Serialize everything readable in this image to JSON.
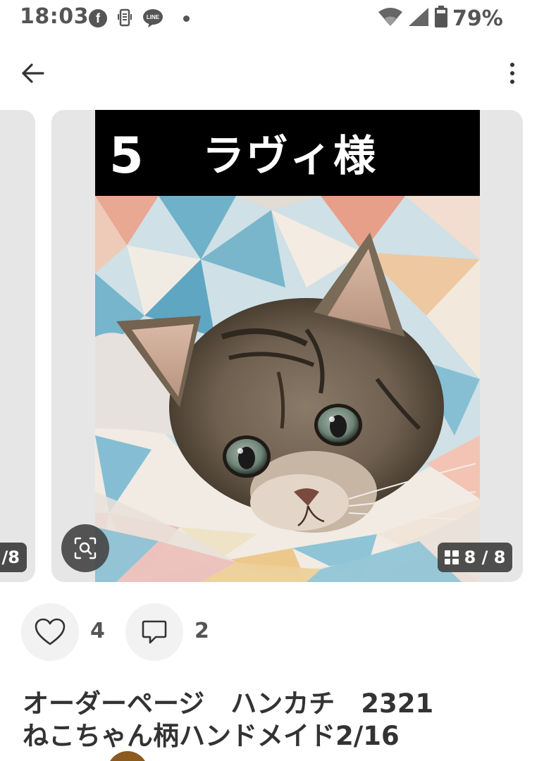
{
  "status_bar": {
    "time": "18:03",
    "battery": "79%",
    "line_label": "LINE"
  },
  "nav": {
    "back_icon": "arrow-left-icon",
    "menu_icon": "more-vertical-icon"
  },
  "carousel": {
    "prev_counter": "/8",
    "image": {
      "number": "5",
      "name": "ラヴィ様",
      "subject": "tabby kitten on pastel knitted blanket"
    },
    "lens_icon": "visual-search-icon",
    "counter": "8 / 8"
  },
  "actions": {
    "like_icon": "heart-outline-icon",
    "like_count": "4",
    "comment_icon": "comment-outline-icon",
    "comment_count": "2"
  },
  "post": {
    "title": "オーダーページ　ハンカチ　2321\nねこちゃん柄ハンドメイド2/16"
  },
  "colors": {
    "badge_bg": "#464646",
    "card_bg": "#e6e6e6",
    "action_bg": "#f2f2f2",
    "avatar": "#8a5a1e"
  }
}
